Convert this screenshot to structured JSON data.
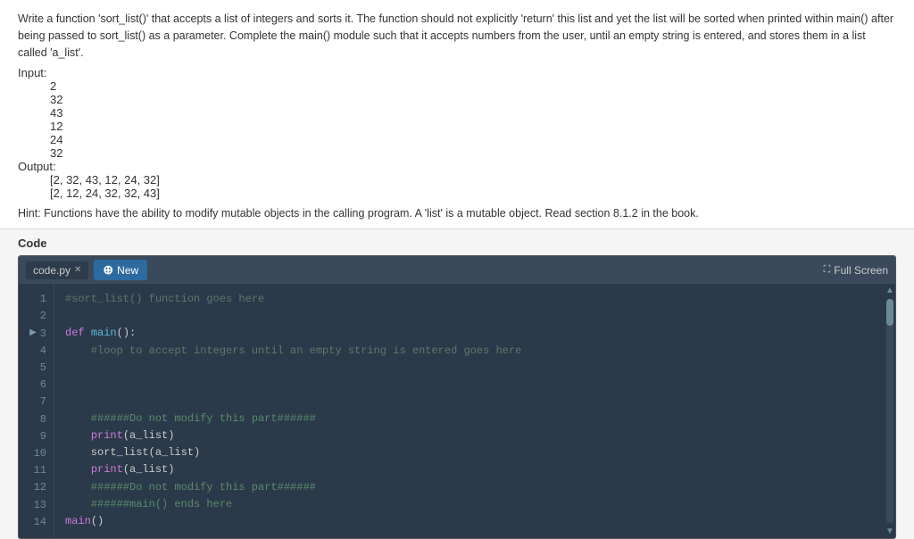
{
  "problem": {
    "description": "Write a function 'sort_list()' that accepts a list of integers and sorts it. The function should not explicitly 'return' this list and yet the list will be sorted when printed within main() after being passed to sort_list() as a parameter. Complete the main() module such that it accepts numbers from the user, until an empty string is entered, and stores them in a list called 'a_list'.",
    "input_label": "Input:",
    "input_values": [
      "2",
      "32",
      "43",
      "12",
      "24",
      "32"
    ],
    "output_label": "Output:",
    "output_values": [
      "[2, 32, 43, 12, 24, 32]",
      "[2, 12, 24, 32, 32, 43]"
    ],
    "hint": "Hint: Functions have the ability to modify mutable objects in the calling program. A 'list' is a mutable object. Read section 8.1.2 in the book."
  },
  "code_section": {
    "label": "Code",
    "tabs": {
      "file_tab": "code.py",
      "new_tab": "New",
      "fullscreen": "Full Screen"
    },
    "lines": [
      {
        "num": "1",
        "arrow": false,
        "content": "#sort_list() function goes here",
        "type": "comment"
      },
      {
        "num": "2",
        "arrow": false,
        "content": "",
        "type": "regular"
      },
      {
        "num": "3",
        "arrow": true,
        "content": "def main():",
        "type": "def"
      },
      {
        "num": "4",
        "arrow": false,
        "content": "    #loop to accept integers until an empty string is entered goes here",
        "type": "comment"
      },
      {
        "num": "5",
        "arrow": false,
        "content": "",
        "type": "regular"
      },
      {
        "num": "6",
        "arrow": false,
        "content": "",
        "type": "regular"
      },
      {
        "num": "7",
        "arrow": false,
        "content": "",
        "type": "regular"
      },
      {
        "num": "8",
        "arrow": false,
        "content": "    ######Do not modify this part######",
        "type": "hash"
      },
      {
        "num": "9",
        "arrow": false,
        "content": "    print(a_list)",
        "type": "print"
      },
      {
        "num": "10",
        "arrow": false,
        "content": "    sort_list(a_list)",
        "type": "regular"
      },
      {
        "num": "11",
        "arrow": false,
        "content": "    print(a_list)",
        "type": "print"
      },
      {
        "num": "12",
        "arrow": false,
        "content": "    ######Do not modify this part######",
        "type": "hash"
      },
      {
        "num": "13",
        "arrow": false,
        "content": "    ######main() ends here",
        "type": "hash"
      },
      {
        "num": "14",
        "arrow": false,
        "content": "main()",
        "type": "main-call"
      }
    ]
  }
}
